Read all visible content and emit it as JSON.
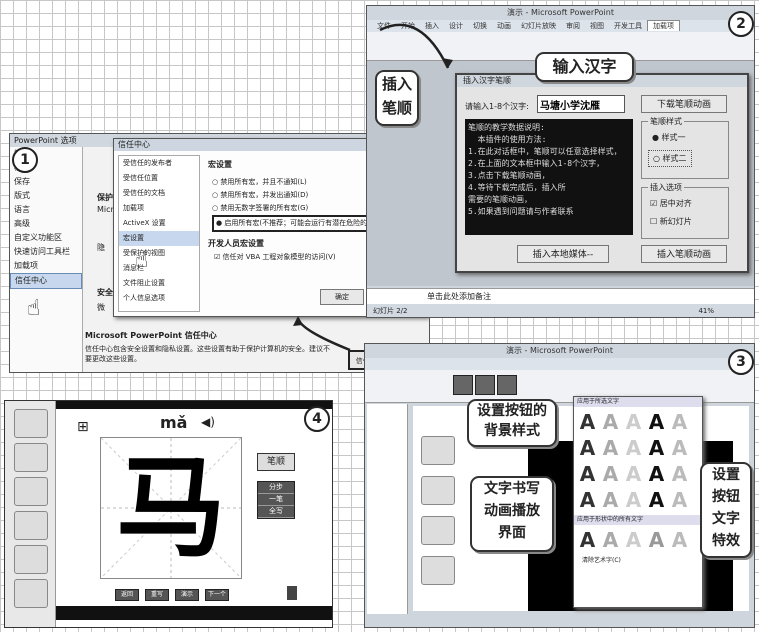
{
  "badges": [
    "1",
    "2",
    "3",
    "4"
  ],
  "panel1": {
    "window_title": "PowerPoint 选项",
    "options_sidebar": [
      "常规",
      "校对",
      "保存",
      "版式",
      "语言",
      "高级",
      "自定义功能区",
      "快速访问工具栏",
      "加载项",
      "信任中心"
    ],
    "trust_center": {
      "title": "信任中心",
      "nav": [
        "受信任的发布者",
        "受信任位置",
        "受信任的文档",
        "加载项",
        "ActiveX 设置",
        "宏设置",
        "受保护的视图",
        "消息栏",
        "文件阻止设置",
        "个人信息选项"
      ],
      "section_macro": "宏设置",
      "radios": [
        "禁用所有宏，并且不通知(L)",
        "禁用所有宏，并发出通知(D)",
        "禁用无数字签署的所有宏(G)",
        "启用所有宏(不推荐；可能会运行有潜在危险的代码)(E)"
      ],
      "section_dev": "开发人员宏设置",
      "checkbox": "信任对 VBA 工程对象模型的访问(V)",
      "ok": "确定",
      "cancel": "取消"
    },
    "left_labels": [
      "保护",
      "Micro",
      "隐",
      "安全",
      "微"
    ],
    "footer_title": "Microsoft PowerPoint 信任中心",
    "footer_text": "信任中心包含安全设置和隐私设置。这些设置有助于保护计算机的安全。建议不要更改这些设置。",
    "trust_button": "信任中心设置(T)..."
  },
  "panel2": {
    "app_title": "演示 - Microsoft PowerPoint",
    "tabs": [
      "文件",
      "开始",
      "插入",
      "设计",
      "切换",
      "动画",
      "幻灯片放映",
      "审阅",
      "视图",
      "开发工具",
      "加载项"
    ],
    "dialog_title": "插入汉字笔顺",
    "prompt": "请输入1-8个汉字:",
    "input_value": "马塘小学沈雁",
    "download_btn": "下载笔顺动画",
    "info_text": "笔顺的教学数据说明:\n  本插件的使用方法:\n1.在此对话框中，笔顺可以任意选择样式，\n2.在上面的文本框中输入1-8个汉字，\n3.点击下载笔顺动画，\n4.等待下载完成后，插入所\n需要的笔顺动画，\n5.如果遇到问题请与作者联系",
    "style_group": "笔顺样式",
    "style1": "样式一",
    "style2": "样式二",
    "insert_group": "插入选项",
    "opt1": "居中对齐",
    "opt2": "新幻灯片",
    "insert_local": "插入本地媒体--",
    "insert_anim": "插入笔顺动画",
    "notes": "单击此处添加备注",
    "status": "幻灯片 2/2",
    "zoom": "41%"
  },
  "panel3": {
    "app_title": "演示 - Microsoft PowerPoint",
    "gallery_title1": "应用于所选文字",
    "gallery_title2": "应用于形状中的所有文字",
    "more": "清除艺术字(C)",
    "glyph": "A"
  },
  "panel4": {
    "pinyin": "mǎ",
    "character": "马",
    "side_label": "笔顺",
    "buttons": [
      "分步",
      "一笔",
      "全写"
    ],
    "bottom": [
      "返回",
      "重写",
      "演示",
      "下一个"
    ]
  },
  "callouts": {
    "insert_stroke": "插入\n笔顺",
    "input_hanzi": "输入汉字",
    "btn_bg": "设置按钮的\n背景样式",
    "anim": "文字书写\n动画播放\n界面",
    "btn_text": "设置\n按钮\n文字\n特效"
  }
}
